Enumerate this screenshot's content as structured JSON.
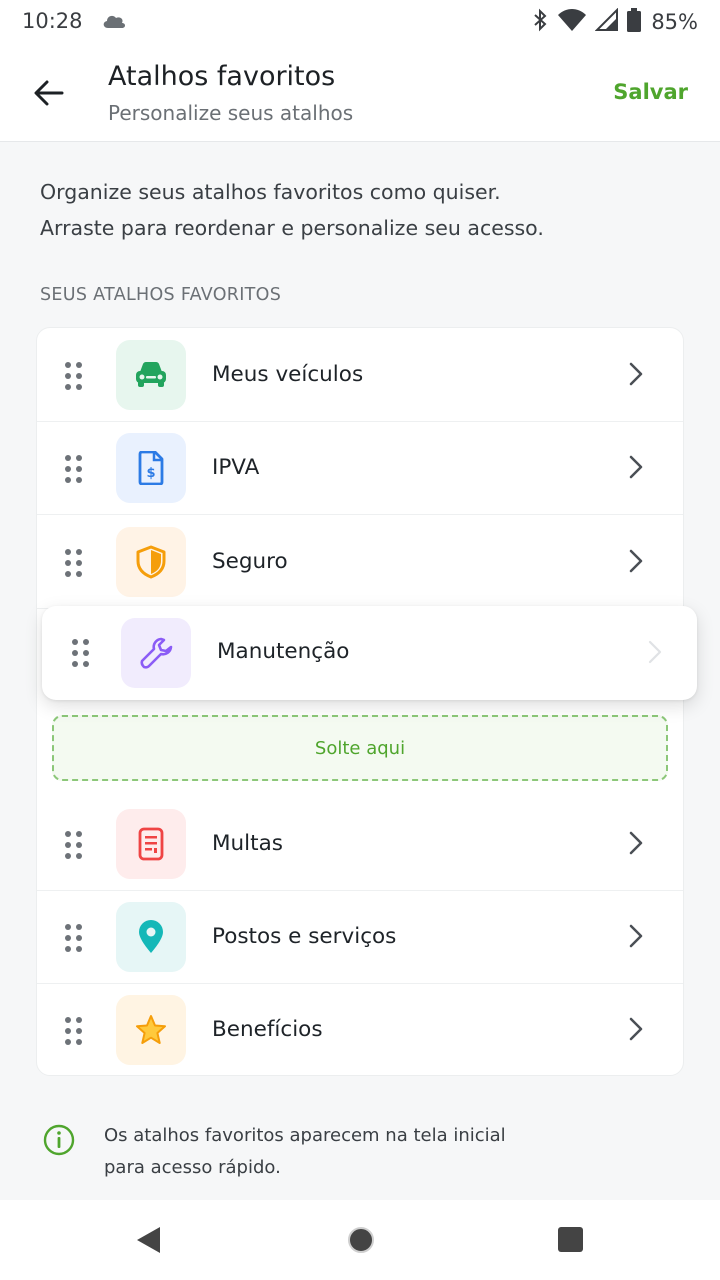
{
  "status": {
    "time": "10:28",
    "battery": "85%",
    "icons": [
      "cloud-icon",
      "bluetooth-icon",
      "wifi-icon",
      "signal-icon",
      "battery-icon"
    ]
  },
  "header": {
    "title": "Atalhos favoritos",
    "subtitle": "Personalize seus atalhos",
    "save_label": "Salvar",
    "back_icon": "arrow-left-icon"
  },
  "intro": {
    "line1": "Organize seus atalhos favoritos como quiser.",
    "line2": "Arraste para reordenar e personalize seu acesso."
  },
  "section_label": "SEUS ATALHOS FAVORITOS",
  "shortcuts": [
    {
      "label": "Meus veículos",
      "icon": "car-icon",
      "color": "#22a45d",
      "tile_bg": "#e7f6ee"
    },
    {
      "label": "IPVA",
      "icon": "document-dollar-icon",
      "color": "#2c7be5",
      "tile_bg": "#e9f1fe"
    },
    {
      "label": "Seguro",
      "icon": "shield-icon",
      "color": "#f59e0b",
      "tile_bg": "#fff3e6"
    },
    {
      "label": "Multas",
      "icon": "ticket-icon",
      "color": "#ef4444",
      "tile_bg": "#feecec"
    },
    {
      "label": "Postos e serviços",
      "icon": "location-pin-icon",
      "color": "#14b8b8",
      "tile_bg": "#e6f6f6"
    },
    {
      "label": "Benefícios",
      "icon": "star-icon",
      "color": "#f5b000",
      "tile_bg": "#fff4e3"
    }
  ],
  "dragging": {
    "label": "Manutenção",
    "icon": "wrench-icon",
    "color": "#8b5cf6",
    "tile_bg": "#f1ecfd"
  },
  "dropzone_label": "Solte aqui",
  "info": {
    "line1": "Os atalhos favoritos aparecem na tela inicial",
    "line2": "para acesso rápido."
  },
  "colors": {
    "accent": "#4fa52d",
    "background": "#f6f7f8"
  }
}
